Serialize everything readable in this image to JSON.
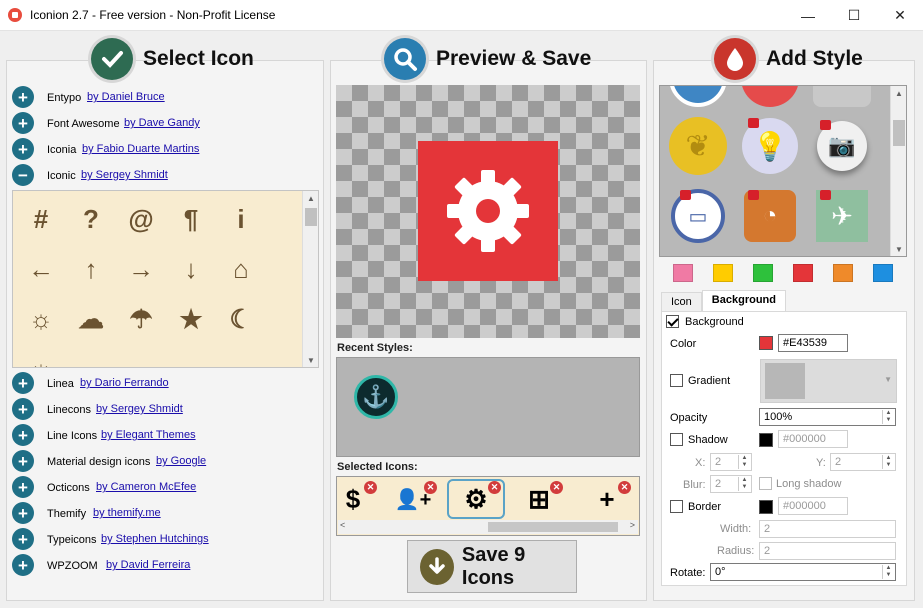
{
  "window": {
    "title": "Iconion 2.7 - Free version - Non-Profit License",
    "minimize": "—",
    "maximize": "☐",
    "close": "✕"
  },
  "select_panel": {
    "heading": "Select Icon",
    "libraries_top": [
      {
        "name": "Entypo",
        "author": "by Daniel Bruce",
        "expanded": false
      },
      {
        "name": "Font Awesome",
        "author": "by Dave Gandy",
        "expanded": false
      },
      {
        "name": "Iconia",
        "author": "by Fabio Duarte Martins",
        "expanded": false
      },
      {
        "name": "Iconic",
        "author": "by Sergey Shmidt",
        "expanded": true
      }
    ],
    "icon_grid": [
      "#",
      "?",
      "@",
      "¶",
      "i",
      "←",
      "↑",
      "→",
      "↓",
      "⌂",
      "☼",
      "☁",
      "☂",
      "★",
      "☾"
    ],
    "libraries_bottom": [
      {
        "name": "Linea",
        "author": "by Dario Ferrando"
      },
      {
        "name": "Linecons",
        "author": "by Sergey Shmidt"
      },
      {
        "name": "Line Icons",
        "author": "by Elegant Themes"
      },
      {
        "name": "Material design icons",
        "author": "by Google"
      },
      {
        "name": "Octicons",
        "author": "by Cameron McEfee"
      },
      {
        "name": "Themify",
        "author": "by themify.me"
      },
      {
        "name": "Typeicons",
        "author": "by Stephen Hutchings"
      },
      {
        "name": "WPZOOM",
        "author": "by David Ferreira"
      }
    ]
  },
  "preview_panel": {
    "heading": "Preview & Save",
    "preview_icon": "gear-icon",
    "preview_color": "#E43539",
    "recent_styles_label": "Recent Styles:",
    "selected_icons_label": "Selected Icons:",
    "selected_icons": [
      "$",
      "👤+",
      "⚙",
      "⊞",
      "+"
    ],
    "save_button": "Save 9 Icons"
  },
  "style_panel": {
    "heading": "Add Style",
    "swatches": [
      "#f07aa4",
      "#ffcc00",
      "#2ec13c",
      "#e43539",
      "#ef8a2a",
      "#1e8fe0"
    ],
    "tabs": [
      "Icon",
      "Background"
    ],
    "active_tab": "Background",
    "background_check": "Background",
    "color_label": "Color",
    "color_value": "#E43539",
    "gradient_label": "Gradient",
    "opacity_label": "Opacity",
    "opacity_value": "100%",
    "shadow_label": "Shadow",
    "shadow_color": "#000000",
    "x_label": "X:",
    "x_value": "2",
    "y_label": "Y:",
    "y_value": "2",
    "blur_label": "Blur:",
    "blur_value": "2",
    "long_shadow_label": "Long shadow",
    "border_label": "Border",
    "border_color": "#000000",
    "width_label": "Width:",
    "width_value": "2",
    "radius_label": "Radius:",
    "radius_value": "2",
    "rotate_label": "Rotate:",
    "rotate_value": "0°"
  }
}
